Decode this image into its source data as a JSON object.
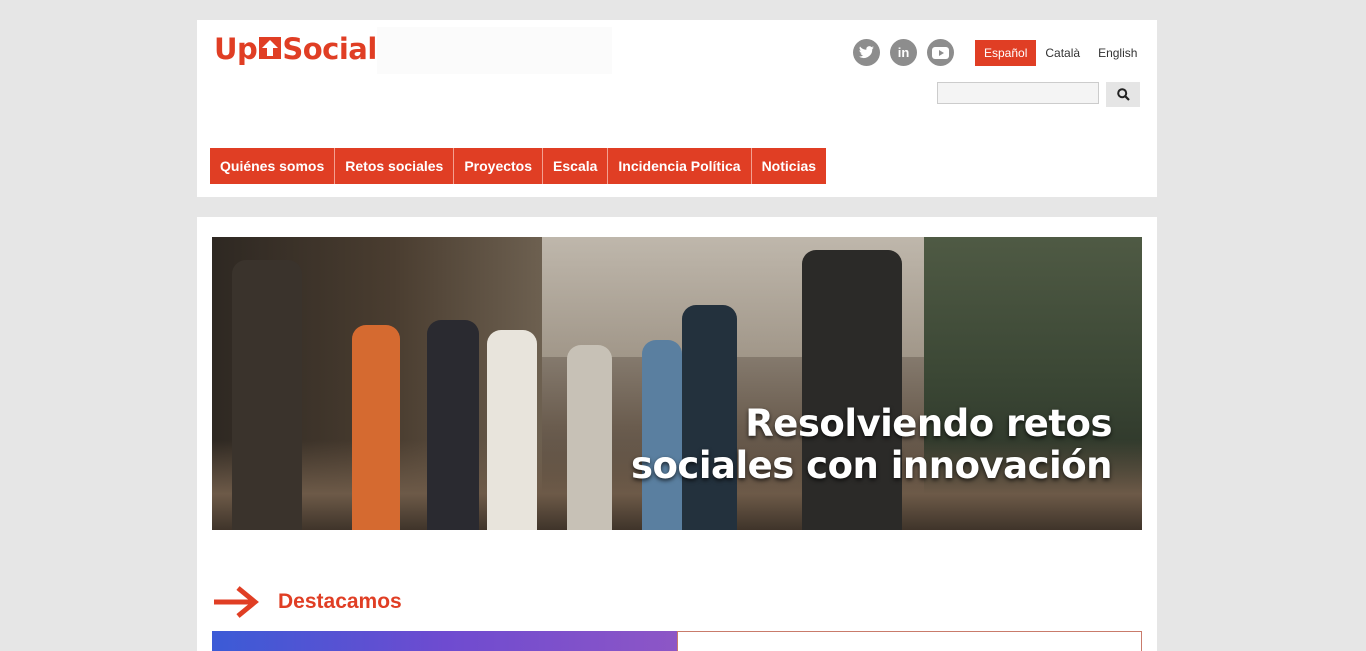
{
  "brand": {
    "logo_left": "Up",
    "logo_right": "Social",
    "accent": "#e03e24"
  },
  "social": [
    {
      "name": "twitter-icon",
      "glyph": "🐦"
    },
    {
      "name": "linkedin-icon",
      "glyph": "in"
    },
    {
      "name": "youtube-icon",
      "glyph": "▶"
    }
  ],
  "languages": [
    "Español",
    "Català",
    "English"
  ],
  "language_active": "Español",
  "search": {
    "value": "",
    "button_icon": "search-icon"
  },
  "nav": [
    "Quiénes somos",
    "Retos sociales",
    "Proyectos",
    "Escala",
    "Incidencia Política",
    "Noticias"
  ],
  "hero": {
    "line1": "Resolviendo retos",
    "line2": "sociales con innovación"
  },
  "featured": {
    "title": "Destacamos"
  }
}
